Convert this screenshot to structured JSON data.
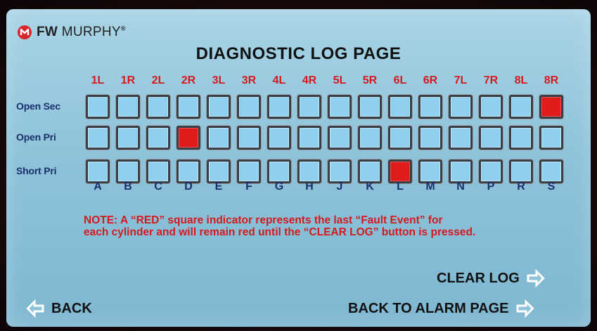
{
  "brand": {
    "name_bold": "FW",
    "name_light": "MURPHY",
    "trademark": "®"
  },
  "title": "DIAGNOSTIC LOG PAGE",
  "columns": [
    "1L",
    "1R",
    "2L",
    "2R",
    "3L",
    "3R",
    "4L",
    "4R",
    "5L",
    "5R",
    "6L",
    "6R",
    "7L",
    "7R",
    "8L",
    "8R"
  ],
  "rows": [
    {
      "label": "Open Sec",
      "states": [
        0,
        0,
        0,
        0,
        0,
        0,
        0,
        0,
        0,
        0,
        0,
        0,
        0,
        0,
        0,
        1
      ]
    },
    {
      "label": "Open Pri",
      "states": [
        0,
        0,
        0,
        1,
        0,
        0,
        0,
        0,
        0,
        0,
        0,
        0,
        0,
        0,
        0,
        0
      ]
    },
    {
      "label": "Short Pri",
      "states": [
        0,
        0,
        0,
        0,
        0,
        0,
        0,
        0,
        0,
        0,
        1,
        0,
        0,
        0,
        0,
        0
      ]
    }
  ],
  "cylinder_letters": [
    "A",
    "B",
    "C",
    "D",
    "E",
    "F",
    "G",
    "H",
    "J",
    "K",
    "L",
    "M",
    "N",
    "P",
    "R",
    "S"
  ],
  "note_line1": "NOTE: A “RED” square indicator represents the last “Fault Event”  for",
  "note_line2": "each cylinder and will remain red until the “CLEAR LOG” button is pressed.",
  "buttons": {
    "clear_log": "CLEAR LOG",
    "back": "BACK",
    "back_to_alarm": "BACK TO ALARM PAGE"
  },
  "colors": {
    "fault": "#e01b1b",
    "normal": "#8fd0ee",
    "header_red": "#d41a1f",
    "label_navy": "#1b2f6b"
  },
  "icons": {
    "logo": "murphy-logo-icon",
    "arrow_right": "arrow-right-outline-icon",
    "arrow_left": "arrow-left-outline-icon"
  }
}
